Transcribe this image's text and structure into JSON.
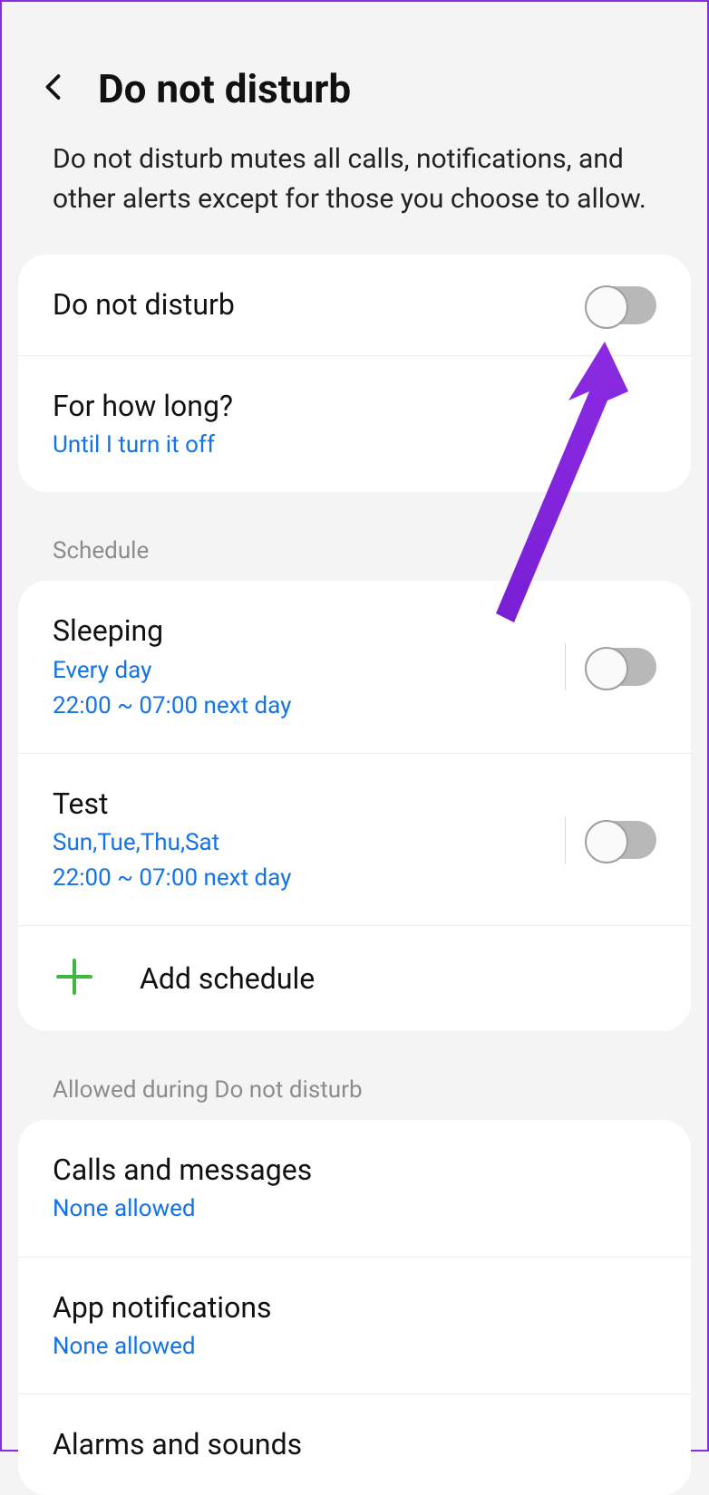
{
  "header": {
    "title": "Do not disturb"
  },
  "description": "Do not disturb mutes all calls, notifications, and other alerts except for those you choose to allow.",
  "main": {
    "dnd_label": "Do not disturb",
    "duration_label": "For how long?",
    "duration_value": "Until I turn it off"
  },
  "sections": {
    "schedule": "Schedule",
    "allowed": "Allowed during Do not disturb"
  },
  "schedules": [
    {
      "name": "Sleeping",
      "days": "Every day",
      "time": "22:00 ~ 07:00 next day"
    },
    {
      "name": "Test",
      "days": "Sun,Tue,Thu,Sat",
      "time": "22:00 ~ 07:00 next day"
    }
  ],
  "add_schedule": "Add schedule",
  "allowed_items": [
    {
      "label": "Calls and messages",
      "value": "None allowed"
    },
    {
      "label": "App notifications",
      "value": "None allowed"
    },
    {
      "label": "Alarms and sounds",
      "value": ""
    }
  ]
}
